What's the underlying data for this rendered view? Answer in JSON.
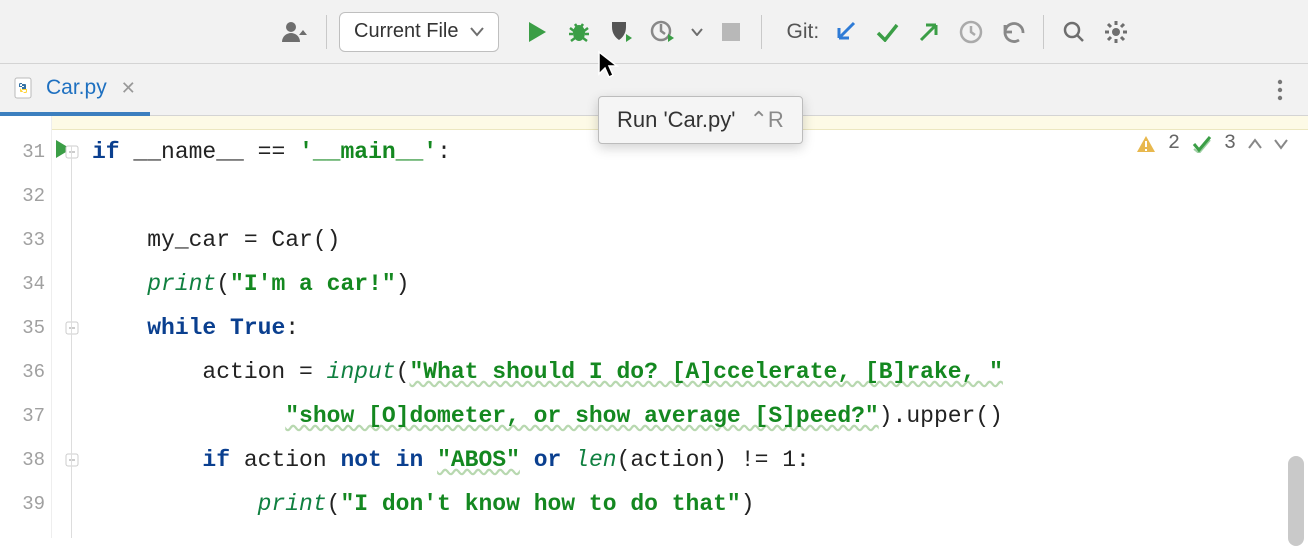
{
  "toolbar": {
    "config_label": "Current File",
    "git_label": "Git:"
  },
  "tab": {
    "filename": "Car.py"
  },
  "tooltip": {
    "text": "Run 'Car.py'",
    "shortcut": "⌃R"
  },
  "inspections": {
    "warn_count": "2",
    "ok_count": "3"
  },
  "gutter": {
    "lines": [
      "31",
      "32",
      "33",
      "34",
      "35",
      "36",
      "37",
      "38",
      "39"
    ]
  },
  "code": {
    "l31": {
      "kw_if": "if",
      "name": " __name__ ",
      "eq": "== ",
      "str": "'__main__'",
      "colon": ":"
    },
    "l33": {
      "pre": "    my_car = Car()"
    },
    "l34": {
      "pre": "    ",
      "fn": "print",
      "open": "(",
      "str": "\"I'm a car!\"",
      "close": ")"
    },
    "l35": {
      "pre": "    ",
      "kw": "while True",
      "colon": ":"
    },
    "l36": {
      "pre": "        action = ",
      "fn": "input",
      "open": "(",
      "str": "\"What should I do? [A]ccelerate, [B]rake, \""
    },
    "l37": {
      "pre": "              ",
      "str": "\"show [O]dometer, or show average [S]peed?\"",
      "tail": ").upper()"
    },
    "l38": {
      "pre": "        ",
      "kw_if": "if",
      "mid1": " action ",
      "kw_notin": "not in ",
      "str": "\"ABOS\"",
      "mid2": " ",
      "kw_or": "or ",
      "fn": "len",
      "rest": "(action) != 1:"
    },
    "l39": {
      "pre": "            ",
      "fn": "print",
      "open": "(",
      "str": "\"I don't know how to do that\"",
      "close": ")"
    }
  }
}
